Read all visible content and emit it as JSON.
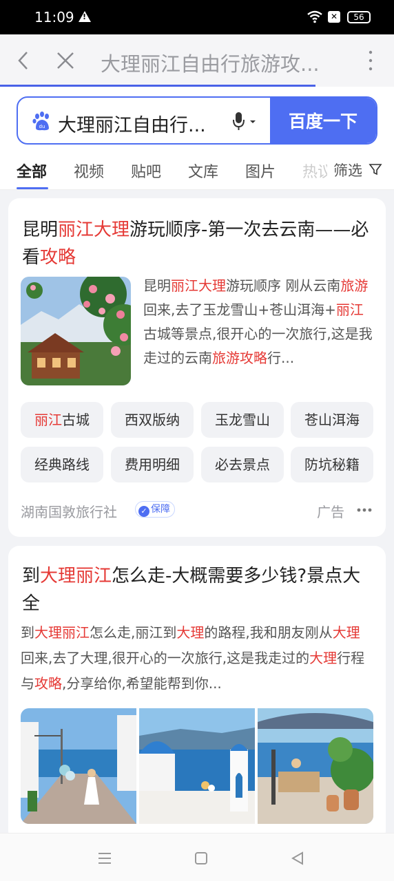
{
  "status": {
    "time": "11:09",
    "battery": "56"
  },
  "browser": {
    "title": "大理丽江自由行旅游攻..."
  },
  "search": {
    "query": "大理丽江自由行...",
    "button": "百度一下"
  },
  "tabs": {
    "items": [
      "全部",
      "视频",
      "贴吧",
      "文库",
      "图片",
      "热议"
    ],
    "filter": "筛选"
  },
  "result1": {
    "title_parts": [
      "昆明",
      "丽江大理",
      "游玩顺序-第一次去云南——必看",
      "攻略"
    ],
    "snippet_parts": [
      "昆明",
      "丽江大理",
      "游玩顺序 刚从云南",
      "旅游",
      "回来,去了玉龙雪山+苍山洱海+",
      "丽江",
      "古城等景点,很开心的一次旅行,这是我走过的云南",
      "旅游攻略",
      "行..."
    ],
    "chips": [
      {
        "hl": "丽江",
        "rest": "古城"
      },
      {
        "hl": "",
        "rest": "西双版纳"
      },
      {
        "hl": "",
        "rest": "玉龙雪山"
      },
      {
        "hl": "",
        "rest": "苍山洱海"
      },
      {
        "hl": "",
        "rest": "经典路线"
      },
      {
        "hl": "",
        "rest": "费用明细"
      },
      {
        "hl": "",
        "rest": "必去景点"
      },
      {
        "hl": "",
        "rest": "防坑秘籍"
      }
    ],
    "source": "湖南国敦旅行社",
    "badge": "保障",
    "ad": "广告"
  },
  "result2": {
    "title_parts": [
      "到",
      "大理丽江",
      "怎么走-大概需要多少钱?景点大全"
    ],
    "snippet_parts": [
      "到",
      "大理丽江",
      "怎么走,丽江到",
      "大理",
      "的路程,我和朋友刚从",
      "大理",
      "回来,去了大理,很开心的一次旅行,这是我走过的",
      "大理",
      "行程与",
      "攻略",
      ",分享给你,希望能帮到你..."
    ]
  },
  "colors": {
    "accent": "#4e6ef2",
    "highlight": "#e53935"
  },
  "icons": [
    "warning-icon",
    "wifi-icon",
    "x-icon",
    "battery-icon",
    "back-icon",
    "close-icon",
    "more-vertical-icon",
    "baidu-paw-icon",
    "microphone-icon",
    "filter-icon",
    "more-dots-icon",
    "menu-icon",
    "home-icon",
    "back-triangle-icon"
  ]
}
